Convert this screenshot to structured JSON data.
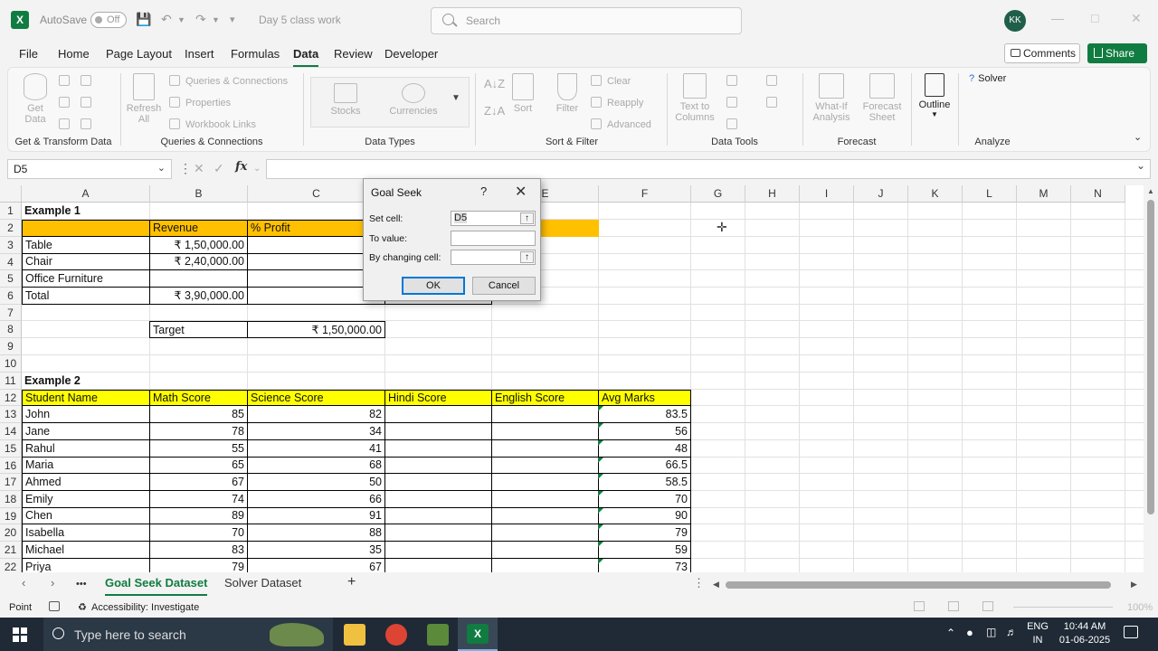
{
  "titlebar": {
    "app_logo": "X",
    "autosave_label": "AutoSave",
    "autosave_state": "Off",
    "doc_title": "Day 5 class work",
    "search_placeholder": "Search",
    "user_initials": "KK"
  },
  "menu": {
    "tabs": [
      "File",
      "Home",
      "Page Layout",
      "Insert",
      "Formulas",
      "Data",
      "Review",
      "Developer"
    ],
    "active_tab": "Data",
    "comments_label": "Comments",
    "share_label": "Share"
  },
  "ribbon": {
    "groups": {
      "get_transform": "Get & Transform Data",
      "queries": "Queries & Connections",
      "data_types": "Data Types",
      "sort_filter": "Sort & Filter",
      "data_tools": "Data Tools",
      "forecast": "Forecast",
      "analyze": "Analyze"
    },
    "get_data": "Get\nData",
    "refresh_all": "Refresh\nAll",
    "queries_connections": "Queries & Connections",
    "properties": "Properties",
    "workbook_links": "Workbook Links",
    "stocks": "Stocks",
    "currencies": "Currencies",
    "sort": "Sort",
    "filter": "Filter",
    "clear": "Clear",
    "reapply": "Reapply",
    "advanced": "Advanced",
    "text_to_columns": "Text to\nColumns",
    "what_if": "What-If\nAnalysis",
    "forecast_sheet": "Forecast\nSheet",
    "outline": "Outline",
    "solver": "Solver"
  },
  "formula_bar": {
    "name_box": "D5",
    "fx_label": "fx",
    "formula": ""
  },
  "grid": {
    "columns": [
      "A",
      "B",
      "C",
      "D",
      "E",
      "F",
      "G",
      "H",
      "I",
      "J",
      "K",
      "L",
      "M",
      "N"
    ],
    "rows": [
      "1",
      "2",
      "3",
      "4",
      "5",
      "6",
      "7",
      "8",
      "9",
      "10",
      "11",
      "12",
      "13",
      "14",
      "15",
      "16",
      "17",
      "18",
      "19",
      "20",
      "21",
      "22"
    ],
    "example1": {
      "title": "Example 1",
      "headers": [
        "Revenue",
        "% Profit"
      ],
      "items": [
        {
          "name": "Table",
          "revenue": "₹ 1,50,000.00"
        },
        {
          "name": "Chair",
          "revenue": "₹ 2,40,000.00"
        },
        {
          "name": "Office Furniture",
          "revenue": ""
        },
        {
          "name": "Total",
          "revenue": "₹ 3,90,000.00"
        }
      ],
      "target_label": "Target",
      "target_value": "₹ 1,50,000.00"
    },
    "example2": {
      "title": "Example 2",
      "headers": [
        "Student Name",
        "Math Score",
        "Science Score",
        "Hindi Score",
        "English Score",
        "Avg Marks"
      ],
      "students": [
        {
          "name": "John",
          "math": "85",
          "science": "82",
          "avg": "83.5"
        },
        {
          "name": "Jane",
          "math": "78",
          "science": "34",
          "avg": "56"
        },
        {
          "name": "Rahul",
          "math": "55",
          "science": "41",
          "avg": "48"
        },
        {
          "name": "Maria",
          "math": "65",
          "science": "68",
          "avg": "66.5"
        },
        {
          "name": "Ahmed",
          "math": "67",
          "science": "50",
          "avg": "58.5"
        },
        {
          "name": "Emily",
          "math": "74",
          "science": "66",
          "avg": "70"
        },
        {
          "name": "Chen",
          "math": "89",
          "science": "91",
          "avg": "90"
        },
        {
          "name": "Isabella",
          "math": "70",
          "science": "88",
          "avg": "79"
        },
        {
          "name": "Michael",
          "math": "83",
          "science": "35",
          "avg": "59"
        },
        {
          "name": "Priya",
          "math": "79",
          "science": "67",
          "avg": "73"
        }
      ]
    }
  },
  "dialog": {
    "title": "Goal Seek",
    "help": "?",
    "close": "✕",
    "set_cell_label": "Set cell:",
    "set_cell_value": "D5",
    "to_value_label": "To value:",
    "to_value_value": "",
    "changing_cell_label": "By changing cell:",
    "changing_cell_value": "",
    "ok_label": "OK",
    "cancel_label": "Cancel"
  },
  "sheets": {
    "tabs": [
      "Goal Seek Dataset",
      "Solver Dataset"
    ],
    "active": "Goal Seek Dataset",
    "more": "•••",
    "add": "+"
  },
  "status": {
    "mode": "Point",
    "accessibility": "Accessibility: Investigate",
    "zoom": "100%"
  },
  "taskbar": {
    "search_placeholder": "Type here to search",
    "lang": "ENG",
    "region": "IN",
    "time": "10:44 AM",
    "date": "01-06-2025"
  },
  "colors": {
    "excel_green": "#107c41",
    "header_orange": "#ffc000",
    "header_yellow": "#ffff00"
  }
}
